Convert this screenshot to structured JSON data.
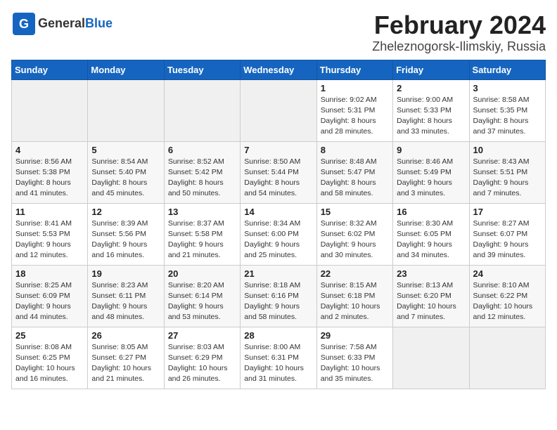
{
  "header": {
    "logo_general": "General",
    "logo_blue": "Blue",
    "month_title": "February 2024",
    "location": "Zheleznogorsk-Ilimskiy, Russia"
  },
  "days_of_week": [
    "Sunday",
    "Monday",
    "Tuesday",
    "Wednesday",
    "Thursday",
    "Friday",
    "Saturday"
  ],
  "weeks": [
    [
      {
        "day": "",
        "info": ""
      },
      {
        "day": "",
        "info": ""
      },
      {
        "day": "",
        "info": ""
      },
      {
        "day": "",
        "info": ""
      },
      {
        "day": "1",
        "info": "Sunrise: 9:02 AM\nSunset: 5:31 PM\nDaylight: 8 hours\nand 28 minutes."
      },
      {
        "day": "2",
        "info": "Sunrise: 9:00 AM\nSunset: 5:33 PM\nDaylight: 8 hours\nand 33 minutes."
      },
      {
        "day": "3",
        "info": "Sunrise: 8:58 AM\nSunset: 5:35 PM\nDaylight: 8 hours\nand 37 minutes."
      }
    ],
    [
      {
        "day": "4",
        "info": "Sunrise: 8:56 AM\nSunset: 5:38 PM\nDaylight: 8 hours\nand 41 minutes."
      },
      {
        "day": "5",
        "info": "Sunrise: 8:54 AM\nSunset: 5:40 PM\nDaylight: 8 hours\nand 45 minutes."
      },
      {
        "day": "6",
        "info": "Sunrise: 8:52 AM\nSunset: 5:42 PM\nDaylight: 8 hours\nand 50 minutes."
      },
      {
        "day": "7",
        "info": "Sunrise: 8:50 AM\nSunset: 5:44 PM\nDaylight: 8 hours\nand 54 minutes."
      },
      {
        "day": "8",
        "info": "Sunrise: 8:48 AM\nSunset: 5:47 PM\nDaylight: 8 hours\nand 58 minutes."
      },
      {
        "day": "9",
        "info": "Sunrise: 8:46 AM\nSunset: 5:49 PM\nDaylight: 9 hours\nand 3 minutes."
      },
      {
        "day": "10",
        "info": "Sunrise: 8:43 AM\nSunset: 5:51 PM\nDaylight: 9 hours\nand 7 minutes."
      }
    ],
    [
      {
        "day": "11",
        "info": "Sunrise: 8:41 AM\nSunset: 5:53 PM\nDaylight: 9 hours\nand 12 minutes."
      },
      {
        "day": "12",
        "info": "Sunrise: 8:39 AM\nSunset: 5:56 PM\nDaylight: 9 hours\nand 16 minutes."
      },
      {
        "day": "13",
        "info": "Sunrise: 8:37 AM\nSunset: 5:58 PM\nDaylight: 9 hours\nand 21 minutes."
      },
      {
        "day": "14",
        "info": "Sunrise: 8:34 AM\nSunset: 6:00 PM\nDaylight: 9 hours\nand 25 minutes."
      },
      {
        "day": "15",
        "info": "Sunrise: 8:32 AM\nSunset: 6:02 PM\nDaylight: 9 hours\nand 30 minutes."
      },
      {
        "day": "16",
        "info": "Sunrise: 8:30 AM\nSunset: 6:05 PM\nDaylight: 9 hours\nand 34 minutes."
      },
      {
        "day": "17",
        "info": "Sunrise: 8:27 AM\nSunset: 6:07 PM\nDaylight: 9 hours\nand 39 minutes."
      }
    ],
    [
      {
        "day": "18",
        "info": "Sunrise: 8:25 AM\nSunset: 6:09 PM\nDaylight: 9 hours\nand 44 minutes."
      },
      {
        "day": "19",
        "info": "Sunrise: 8:23 AM\nSunset: 6:11 PM\nDaylight: 9 hours\nand 48 minutes."
      },
      {
        "day": "20",
        "info": "Sunrise: 8:20 AM\nSunset: 6:14 PM\nDaylight: 9 hours\nand 53 minutes."
      },
      {
        "day": "21",
        "info": "Sunrise: 8:18 AM\nSunset: 6:16 PM\nDaylight: 9 hours\nand 58 minutes."
      },
      {
        "day": "22",
        "info": "Sunrise: 8:15 AM\nSunset: 6:18 PM\nDaylight: 10 hours\nand 2 minutes."
      },
      {
        "day": "23",
        "info": "Sunrise: 8:13 AM\nSunset: 6:20 PM\nDaylight: 10 hours\nand 7 minutes."
      },
      {
        "day": "24",
        "info": "Sunrise: 8:10 AM\nSunset: 6:22 PM\nDaylight: 10 hours\nand 12 minutes."
      }
    ],
    [
      {
        "day": "25",
        "info": "Sunrise: 8:08 AM\nSunset: 6:25 PM\nDaylight: 10 hours\nand 16 minutes."
      },
      {
        "day": "26",
        "info": "Sunrise: 8:05 AM\nSunset: 6:27 PM\nDaylight: 10 hours\nand 21 minutes."
      },
      {
        "day": "27",
        "info": "Sunrise: 8:03 AM\nSunset: 6:29 PM\nDaylight: 10 hours\nand 26 minutes."
      },
      {
        "day": "28",
        "info": "Sunrise: 8:00 AM\nSunset: 6:31 PM\nDaylight: 10 hours\nand 31 minutes."
      },
      {
        "day": "29",
        "info": "Sunrise: 7:58 AM\nSunset: 6:33 PM\nDaylight: 10 hours\nand 35 minutes."
      },
      {
        "day": "",
        "info": ""
      },
      {
        "day": "",
        "info": ""
      }
    ]
  ]
}
